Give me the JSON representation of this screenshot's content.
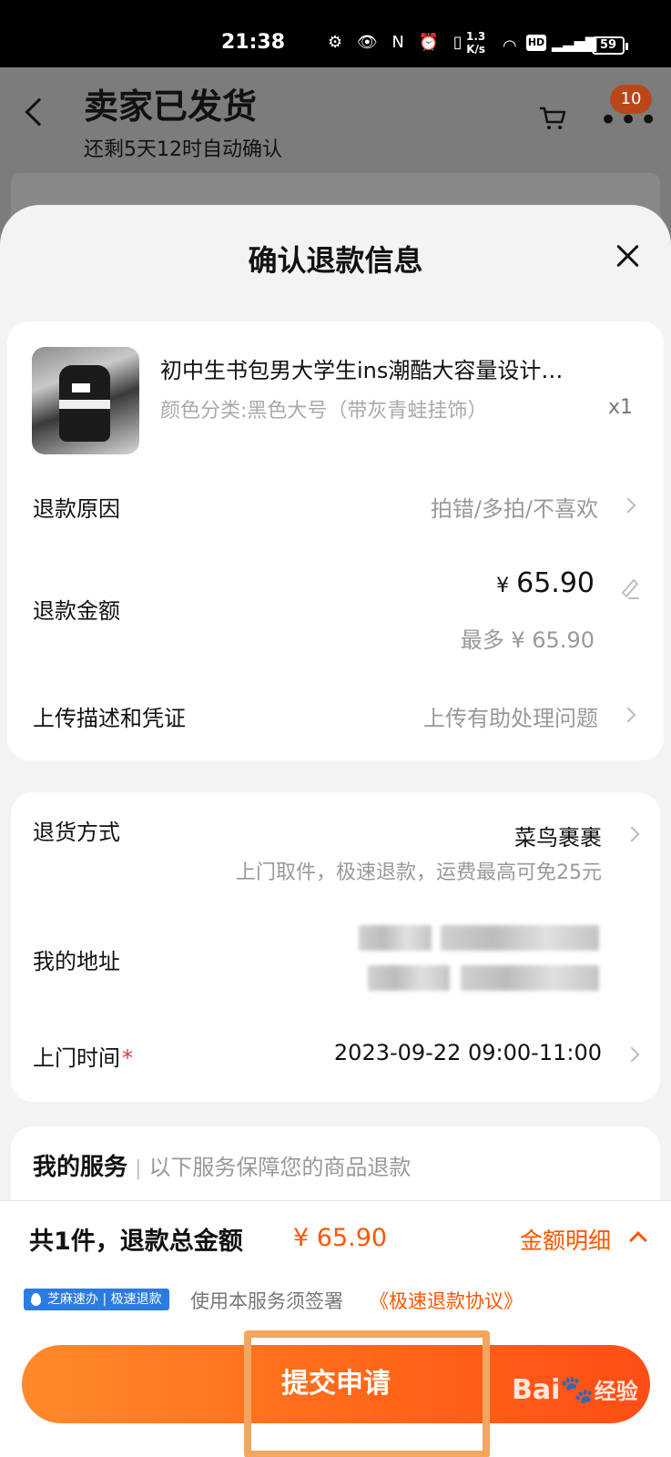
{
  "status_bar": {
    "time": "21:38",
    "icons_text": "⚙ 👁 N ⏰ ▯ ",
    "net_speed_top": "1.3",
    "net_speed_bottom": "K/s",
    "battery": "59"
  },
  "order_header": {
    "title": "卖家已发货",
    "subtitle": "还剩5天12时自动确认",
    "cart_badge": "10"
  },
  "sheet": {
    "title": "确认退款信息"
  },
  "product": {
    "name": "初中生书包男大学生ins潮酷大容量设计…",
    "sku": "颜色分类:黑色大号（带灰青蛙挂饰）",
    "quantity": "x1"
  },
  "refund": {
    "reason_label": "退款原因",
    "reason_value": "拍错/多拍/不喜欢",
    "amount_label": "退款金额",
    "amount_currency": "¥",
    "amount_value": "65.90",
    "amount_max": "最多 ¥ 65.90",
    "upload_label": "上传描述和凭证",
    "upload_value": "上传有助处理问题"
  },
  "return": {
    "method_label": "退货方式",
    "method_value": "菜鸟裹裹",
    "method_note": "上门取件，极速退款，运费最高可免25元",
    "address_label": "我的地址",
    "time_label": "上门时间",
    "time_required": "*",
    "time_value": "2023-09-22 09:00-11:00"
  },
  "services": {
    "title": "我的服务",
    "separator": "|",
    "note": "以下服务保障您的商品退款"
  },
  "bottom_bar": {
    "total_label": "共1件，退款总金额",
    "total_amount": "¥ 65.90",
    "detail_link": "金额明细",
    "zhima_badge": "芝麻速办 | 极速退款",
    "agreement_text": "使用本服务须签署",
    "agreement_link": "《极速退款协议》",
    "submit_label": "提交申请"
  },
  "watermark": {
    "brand": "Bai",
    "brand_cn": "经验"
  }
}
